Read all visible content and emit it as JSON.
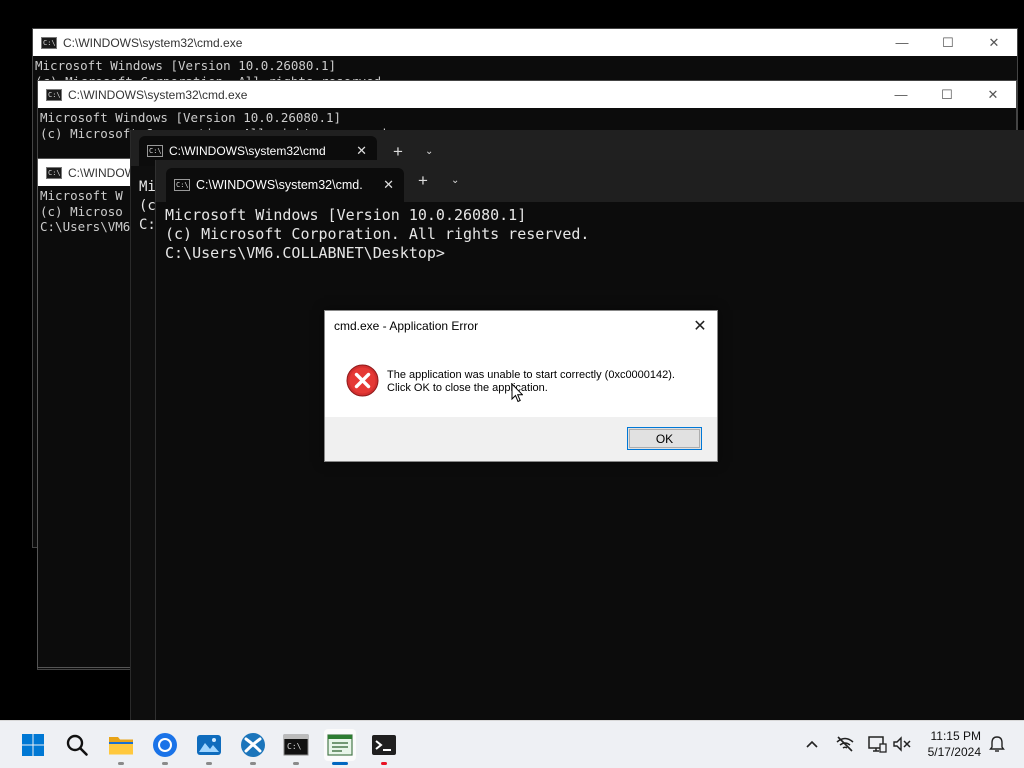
{
  "windows": {
    "back1": {
      "title": "C:\\WINDOWS\\system32\\cmd.exe",
      "lines": [
        "Microsoft Windows [Version 10.0.26080.1]",
        "(c) Microsoft Corporation. All rights reserved."
      ]
    },
    "back2": {
      "title": "C:\\WINDOWS\\system32\\cmd.exe",
      "lines": [
        "Microsoft Windows [Version 10.0.26080.1]",
        "(c) Microsoft Corporation. All rights reserved."
      ]
    },
    "back3": {
      "title": "C:\\WINDOWS",
      "lines": [
        "Microsoft W",
        "(c) Microso",
        "",
        "C:\\Users\\VM6"
      ]
    },
    "back4": {
      "tab_title": "C:\\WINDOWS\\system32\\cmd",
      "lines": [
        "Mi",
        "(c",
        "",
        "C:"
      ]
    },
    "front": {
      "tab_title": "C:\\WINDOWS\\system32\\cmd.",
      "lines": [
        "Microsoft Windows [Version 10.0.26080.1]",
        "(c) Microsoft Corporation. All rights reserved.",
        "",
        "C:\\Users\\VM6.COLLABNET\\Desktop>"
      ]
    }
  },
  "dialog": {
    "title": "cmd.exe - Application Error",
    "message_line1": "The application was unable to start correctly (0xc0000142).",
    "message_line2": "Click OK to close the application.",
    "ok_label": "OK",
    "icon": "error-icon"
  },
  "controls": {
    "minimize": "—",
    "maximize": "☐",
    "close": "✕",
    "new_tab": "+",
    "dropdown": "⌄"
  },
  "taskbar": {
    "items": [
      "start-icon",
      "search-icon",
      "file-explorer-icon",
      "chrome-icon",
      "photos-icon",
      "xbox-icon",
      "cmd-icon",
      "notepad-icon",
      "terminal-icon"
    ],
    "tray": [
      "chevron-up-icon",
      "network-off-icon",
      "display-icon",
      "volume-muted-icon"
    ],
    "time": "11:15 PM",
    "date": "5/17/2024"
  },
  "colors": {
    "console_bg": "#0c0c0c",
    "console_text": "#cccccc",
    "error_red": "#d32f2f",
    "accent": "#0067c0"
  }
}
